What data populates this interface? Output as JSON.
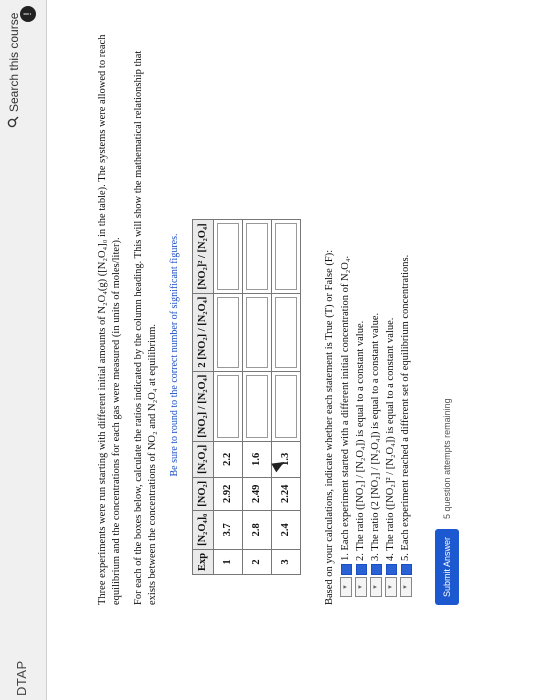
{
  "header": {
    "brand": "DTAP",
    "search_placeholder": "Search this course",
    "info_label": "!"
  },
  "problem": {
    "intro": "Three experiments were run starting with different initial amounts of N₂O₄(g) ([N₂O₄]₀ in the table). The systems were allowed to reach equilibrium and the concentrations for each gas were measured (in units of moles/liter).",
    "instructions": "For each of the boxes below, calculate the ratios indicated by the column heading. This will show the mathematical relationship that exists between the concentrations of NO₂ and N₂O₄ at equilibrium.",
    "note": "Be sure to round to the correct number of significant figures."
  },
  "table": {
    "headers": [
      "Exp",
      "[N₂O₄]₀",
      "[NO₂]",
      "[N₂O₄]",
      "[NO₂] / [N₂O₄]",
      "2 [NO₂] / [N₂O₄]",
      "[NO₂]² / [N₂O₄]"
    ],
    "rows": [
      [
        "1",
        "3.7",
        "2.92",
        "2.2"
      ],
      [
        "2",
        "2.8",
        "2.49",
        "1.6"
      ],
      [
        "3",
        "2.4",
        "2.24",
        "1.3"
      ]
    ]
  },
  "questions": {
    "intro": "Based on your calculations, indicate whether each statement is True (T) or False (F):",
    "statements": [
      "1. Each experiment started with a different initial concentration of N₂O₄.",
      "2. The ratio ([NO₂] / [N₂O₄]) is equal to a constant value.",
      "3. The ratio (2 [NO₂] / [N₂O₄]) is equal to a constant value.",
      "4. The ratio ([NO₂]² / [N₂O₄]) is equal to a constant value.",
      "5. Each experiment reached a different set of equilibrium concentrations."
    ]
  },
  "footer": {
    "submit_label": "Submit Answer",
    "attempts": "5 question attempts remaining"
  }
}
